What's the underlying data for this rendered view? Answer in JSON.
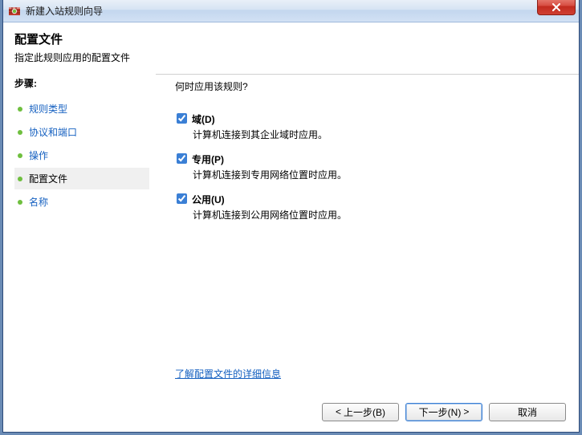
{
  "titlebar": {
    "title": "新建入站规则向导"
  },
  "header": {
    "title": "配置文件",
    "subtitle": "指定此规则应用的配置文件"
  },
  "sidebar": {
    "heading": "步骤:",
    "items": [
      {
        "label": "规则类型",
        "active": false
      },
      {
        "label": "协议和端口",
        "active": false
      },
      {
        "label": "操作",
        "active": false
      },
      {
        "label": "配置文件",
        "active": true
      },
      {
        "label": "名称",
        "active": false
      }
    ]
  },
  "main": {
    "question": "何时应用该规则?",
    "options": [
      {
        "title": "域(D)",
        "desc": "计算机连接到其企业域时应用。",
        "checked": true
      },
      {
        "title": "专用(P)",
        "desc": "计算机连接到专用网络位置时应用。",
        "checked": true
      },
      {
        "title": "公用(U)",
        "desc": "计算机连接到公用网络位置时应用。",
        "checked": true
      }
    ],
    "help_link": "了解配置文件的详细信息"
  },
  "footer": {
    "back": "上一步(B)",
    "next": "下一步(N)",
    "cancel": "取消"
  }
}
